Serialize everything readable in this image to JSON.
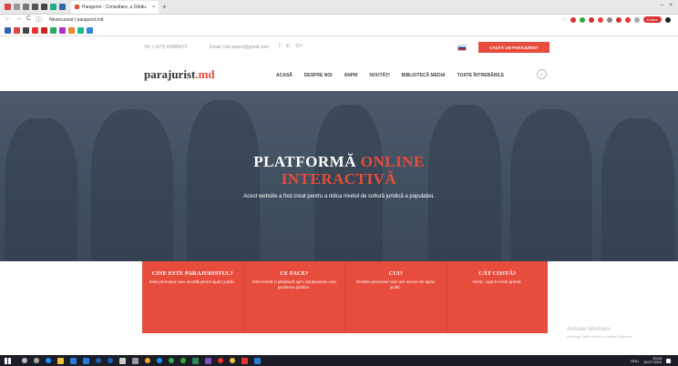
{
  "browser": {
    "tab_title": "Parajurist - Consultare, a Ghidu.",
    "tab_close": "×",
    "new_tab": "+",
    "window_controls": [
      "–",
      "×"
    ],
    "address": "Nesecurizat | parajurist.md",
    "nav": [
      "←",
      "→",
      "C",
      "ⓘ"
    ],
    "extension_pill": "Eroare"
  },
  "infobar": {
    "phone": "Tel: (+373) 60065472",
    "email": "Email: info.anpm@gmail.com",
    "social": [
      "f",
      "in",
      "G+"
    ],
    "cta": "CAUTĂ UN PARAJURIST"
  },
  "header": {
    "logo_main": "parajurist",
    "logo_suffix": ".md",
    "menu": [
      "ACASĂ",
      "DESPRE NOI",
      "ANPM",
      "NOUTĂȚI",
      "BIBLIOTECĂ MEDIA",
      "TOATE ÎNTREBĂRILE"
    ],
    "search_glyph": "⌕"
  },
  "hero": {
    "title_line1_white": "PLATFORMĂ",
    "title_line1_red": "ONLINE",
    "title_line2": "INTERACTIVĂ",
    "subtitle": "Acest website a fost creat pentru a ridica nivelul de cultură juridică a populației."
  },
  "features": [
    {
      "heading": "CINE ESTE PARAJURISTUL?",
      "text": "Este persoana care acordă primul ajutor juridic."
    },
    {
      "heading": "CE FACE?",
      "text": "Informează și ghidează spre soluționarea unei probleme juridice."
    },
    {
      "heading": "CUI?",
      "text": "Oricărei persoane care are nevoie de ajutor juridic."
    },
    {
      "heading": "CÂT COSTĂ?",
      "text": "Nimic. Ajutorul este gratuit."
    }
  ],
  "watermark": {
    "line1": "Activate Windows",
    "line2": "Accesați Setări pentru a activa Windows."
  },
  "taskbar": {
    "time": "10:03",
    "date": "16.07.2019",
    "lang": "ROU"
  },
  "colors": {
    "accent": "#e74c3c",
    "hero_bg": "#4b5a69",
    "taskbar": "#1b1e26"
  }
}
